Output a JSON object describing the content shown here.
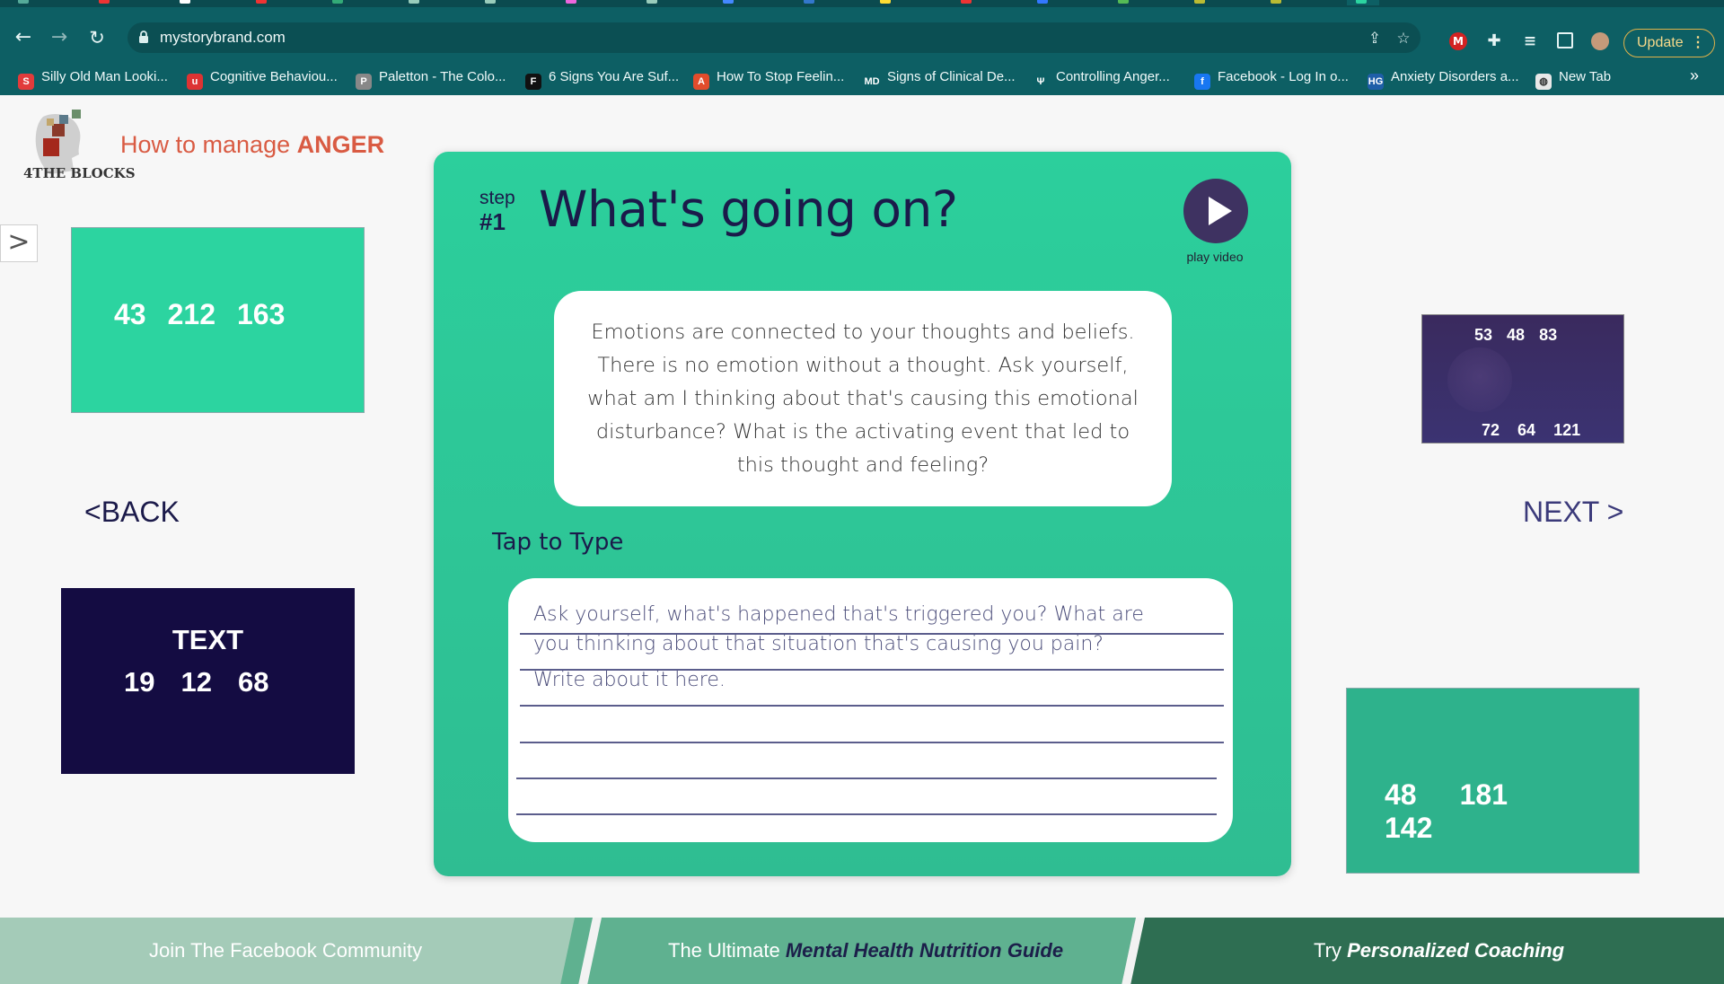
{
  "browser": {
    "url": "mystorybrand.com",
    "update_label": "Update",
    "bookmarks": [
      {
        "label": "Silly Old Man Looki...",
        "icon": "#e23b3b",
        "glyph": "S"
      },
      {
        "label": "Cognitive Behaviou...",
        "icon": "#d33",
        "glyph": "u"
      },
      {
        "label": "Paletton - The Colo...",
        "icon": "#888",
        "glyph": "P"
      },
      {
        "label": "6 Signs You Are Suf...",
        "icon": "#111",
        "glyph": "F"
      },
      {
        "label": "How To Stop Feelin...",
        "icon": "#e24c2c",
        "glyph": "A"
      },
      {
        "label": "Signs of Clinical De...",
        "icon": "#0b5f64",
        "glyph": "MD"
      },
      {
        "label": "Controlling Anger...",
        "icon": "#0b5f64",
        "glyph": "Ψ"
      },
      {
        "label": "Facebook - Log In o...",
        "icon": "#1877f2",
        "glyph": "f"
      },
      {
        "label": "Anxiety Disorders a...",
        "icon": "#1f5fa8",
        "glyph": "HG"
      },
      {
        "label": "New Tab",
        "icon": "#e8e8e8",
        "glyph": "◍"
      }
    ],
    "bookmarks_more": "»"
  },
  "brand": {
    "logo_text": "4THE BLOCKS",
    "title_prefix": "How to manage ",
    "title_emphasis": "ANGER"
  },
  "swatches": {
    "top_left": {
      "values": [
        "43",
        "212",
        "163"
      ],
      "color": "#2cd4a0"
    },
    "bottom_left": {
      "label": "TEXT",
      "values": [
        "19",
        "12",
        "68"
      ],
      "color": "#140c42"
    },
    "top_right": {
      "values_top": [
        "53",
        "48",
        "83"
      ],
      "values_bottom": [
        "72",
        "64",
        "121"
      ]
    },
    "bottom_right": {
      "values": [
        "48",
        "181",
        "142"
      ],
      "color": "#2eb28c"
    }
  },
  "nav": {
    "back_label": "<BACK",
    "next_label": "NEXT >"
  },
  "card": {
    "step_word": "step",
    "step_number": "#1",
    "title": "What's going on?",
    "play_label": "play video",
    "prompt": "Emotions are connected to your thoughts and beliefs. There is no emotion without a thought. Ask yourself, what am I thinking about that's causing this emotional disturbance? What is the activating event that led to this thought and feeling?",
    "tap_label": "Tap to Type",
    "textarea_lines": [
      "Ask yourself, what's happened that's triggered you? What are",
      "you thinking about that situation that's causing you pain?",
      "Write about it here."
    ]
  },
  "footer": {
    "left": "Join The Facebook Community",
    "middle_prefix": "The Ultimate ",
    "middle_emphasis": "Mental Health Nutrition Guide",
    "right_prefix": "Try ",
    "right_emphasis": "Personalized Coaching"
  },
  "colors": {
    "accent_green": "#2ccf9c",
    "navy": "#1b1a4a",
    "brand_red": "#d95b43",
    "browser_teal": "#0d5f64"
  }
}
